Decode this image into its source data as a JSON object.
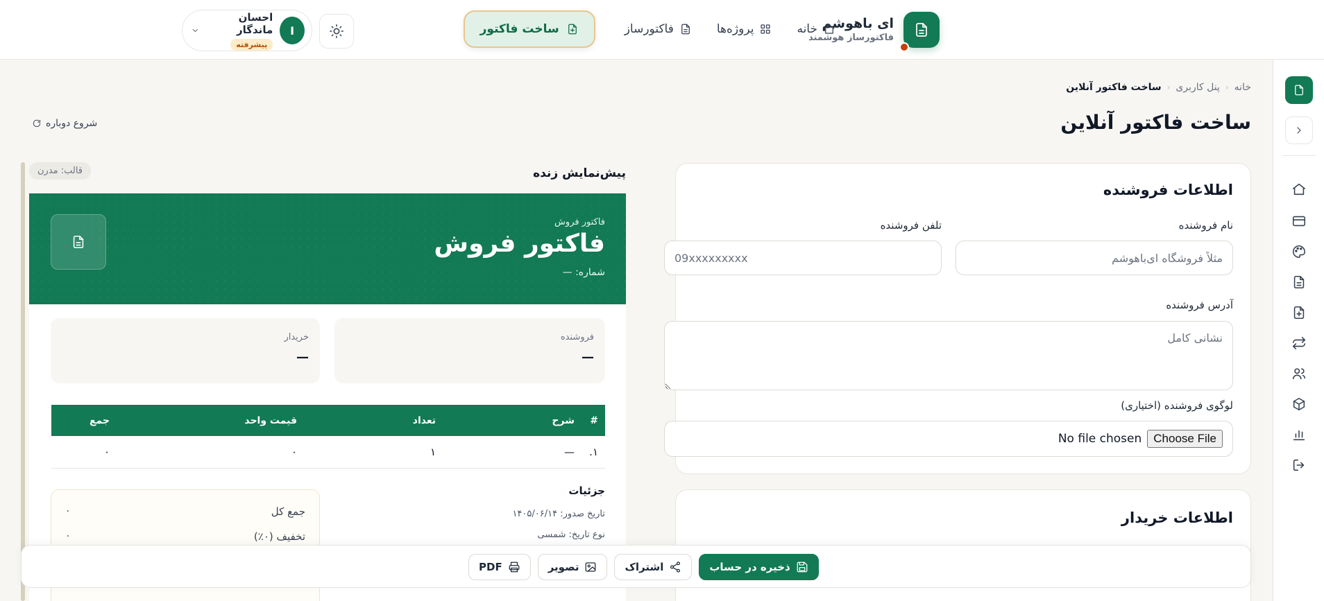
{
  "brand": {
    "name": "ای باهوشم",
    "tagline": "فاکتورساز هوشمند"
  },
  "nav": {
    "home": "خانه",
    "projects": "پروژه‌ها",
    "invoice_maker": "فاکتورساز",
    "create_invoice": "ساخت فاکتور"
  },
  "user": {
    "name": "احسان ماندگار",
    "badge": "پیشرفته",
    "initial": "I"
  },
  "breadcrumb": {
    "home": "خانه",
    "panel": "پنل کاربری",
    "current": "ساخت فاکتور آنلاین"
  },
  "page": {
    "title": "ساخت فاکتور آنلاین",
    "restart": "شروع دوباره"
  },
  "seller_form": {
    "title": "اطلاعات فروشنده",
    "name_label": "نام فروشنده",
    "name_placeholder": "مثلاً فروشگاه ای‌باهوشم",
    "phone_label": "تلفن فروشنده",
    "phone_placeholder": "09xxxxxxxxx",
    "address_label": "آدرس فروشنده",
    "address_placeholder": "نشانی کامل",
    "logo_label": "لوگوی فروشنده (اختیاری)",
    "file_button": "Choose File",
    "file_status": "No file chosen"
  },
  "buyer_form": {
    "title": "اطلاعات خریدار"
  },
  "preview": {
    "label": "پیش‌نمایش زنده",
    "template": "قالب: مدرن",
    "kicker": "فاکتور فروش",
    "title": "فاکتور فروش",
    "number": "شماره: —",
    "seller_label": "فروشنده",
    "seller_value": "—",
    "buyer_label": "خریدار",
    "buyer_value": "—",
    "table": {
      "headers": [
        "#",
        "شرح",
        "تعداد",
        "قیمت واحد",
        "جمع"
      ],
      "rows": [
        [
          "۱.",
          "—",
          "۱",
          "۰",
          "۰"
        ]
      ]
    },
    "details_title": "جزئیات",
    "issue_date": "تاریخ صدور: ۱۴۰۵/۰۶/۱۴",
    "date_type": "نوع تاریخ: شمسی",
    "total_label": "جمع کل",
    "total_value": "۰",
    "discount_label": "تخفیف (۰٪)",
    "discount_value": "۰"
  },
  "actions": {
    "save": "ذخیره در حساب",
    "share": "اشتراک",
    "image": "تصویر",
    "pdf": "PDF"
  },
  "colors": {
    "primary": "#127a55",
    "accent_border": "#e9c68c",
    "badge_bg": "#fdecc8"
  }
}
